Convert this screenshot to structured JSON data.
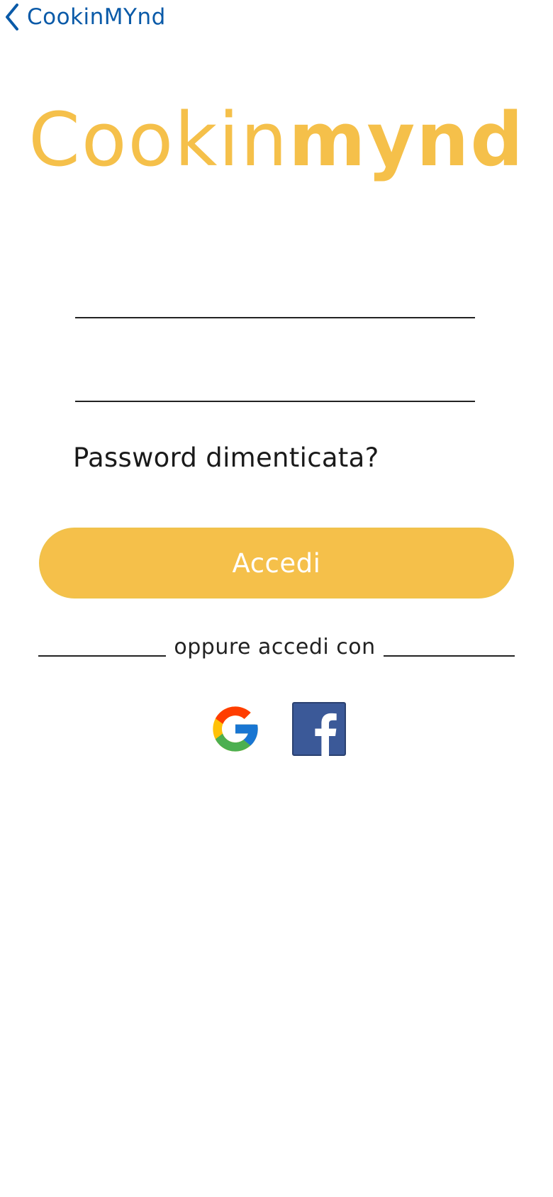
{
  "nav": {
    "back_label": "CookinMYnd",
    "icon": "chevron-left-icon"
  },
  "logo": {
    "part1": "Cookin",
    "part2": "mynd",
    "color": "#f5c04a"
  },
  "form": {
    "username_value": "",
    "password_value": "",
    "forgot_label": "Password dimenticata?",
    "submit_label": "Accedi"
  },
  "social": {
    "divider_label": "oppure accedi con",
    "providers": [
      {
        "name": "Google",
        "icon": "google-icon"
      },
      {
        "name": "Facebook",
        "icon": "facebook-icon",
        "color": "#3b5998"
      }
    ]
  },
  "colors": {
    "accent": "#f5c04a",
    "nav_link": "#0a5aa8"
  }
}
